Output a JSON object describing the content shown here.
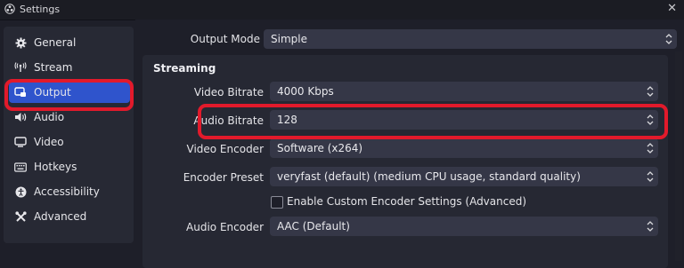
{
  "window": {
    "title": "Settings",
    "close_glyph": "✕"
  },
  "sidebar": {
    "items": [
      {
        "label": "General",
        "icon": "gear-icon"
      },
      {
        "label": "Stream",
        "icon": "antenna-icon"
      },
      {
        "label": "Output",
        "icon": "output-icon",
        "active": true
      },
      {
        "label": "Audio",
        "icon": "speaker-icon"
      },
      {
        "label": "Video",
        "icon": "monitor-icon"
      },
      {
        "label": "Hotkeys",
        "icon": "keyboard-icon"
      },
      {
        "label": "Accessibility",
        "icon": "accessibility-icon"
      },
      {
        "label": "Advanced",
        "icon": "wrench-icon"
      }
    ]
  },
  "output": {
    "mode_label": "Output Mode",
    "mode_value": "Simple",
    "streaming_title": "Streaming",
    "video_bitrate_label": "Video Bitrate",
    "video_bitrate_value": "4000 Kbps",
    "audio_bitrate_label": "Audio Bitrate",
    "audio_bitrate_value": "128",
    "video_encoder_label": "Video Encoder",
    "video_encoder_value": "Software (x264)",
    "encoder_preset_label": "Encoder Preset",
    "encoder_preset_value": "veryfast (default) (medium CPU usage, standard quality)",
    "custom_encoder_label": "Enable Custom Encoder Settings (Advanced)",
    "custom_encoder_checked": false,
    "audio_encoder_label": "Audio Encoder",
    "audio_encoder_value": "AAC (Default)"
  },
  "colors": {
    "accent": "#2f54cc",
    "highlight": "#e21a2b"
  }
}
